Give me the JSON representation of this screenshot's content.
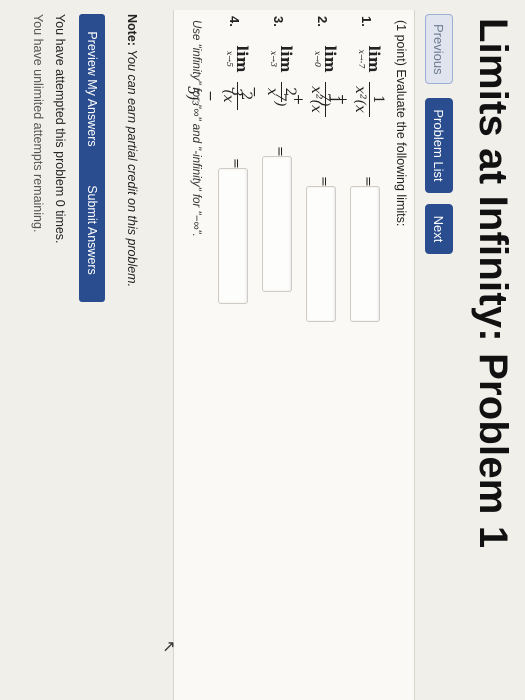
{
  "page": {
    "title": "Limits at Infinity: Problem 1"
  },
  "nav": {
    "previous_label": "Previous",
    "problem_list_label": "Problem List",
    "next_label": "Next"
  },
  "problem": {
    "intro": "(1 point) Evaluate the following limits:",
    "items": [
      {
        "number": "1.",
        "lim_sub": "x→-7",
        "numerator": "1",
        "denominator": "x²(x + 7)",
        "answer": ""
      },
      {
        "number": "2.",
        "lim_sub": "x→0",
        "numerator": "1",
        "denominator": "x²(x + 7)",
        "answer": ""
      },
      {
        "number": "3.",
        "lim_sub": "x→3",
        "numerator": "2",
        "denominator": "x − 3",
        "answer": ""
      },
      {
        "number": "4.",
        "lim_sub": "x→5",
        "numerator": "2",
        "denominator": "(x − 5)³",
        "answer": ""
      }
    ],
    "lim_word": "lim",
    "equals": "=",
    "hint": "Use \"infinity\" for \"∞\" and \"-infinity\" for \"−∞\"."
  },
  "note": {
    "label": "Note:",
    "text": "You can earn partial credit on this problem."
  },
  "actions": {
    "preview_label": "Preview My Answers",
    "submit_label": "Submit Answers"
  },
  "status": {
    "attempts": "You have attempted this problem 0 times.",
    "cutoff_line": "You have unlimited attempts remaining."
  },
  "colors": {
    "primary_button": "#2a4d8f",
    "disabled_button": "#dfe4ee",
    "page_background": "#f1efea"
  }
}
